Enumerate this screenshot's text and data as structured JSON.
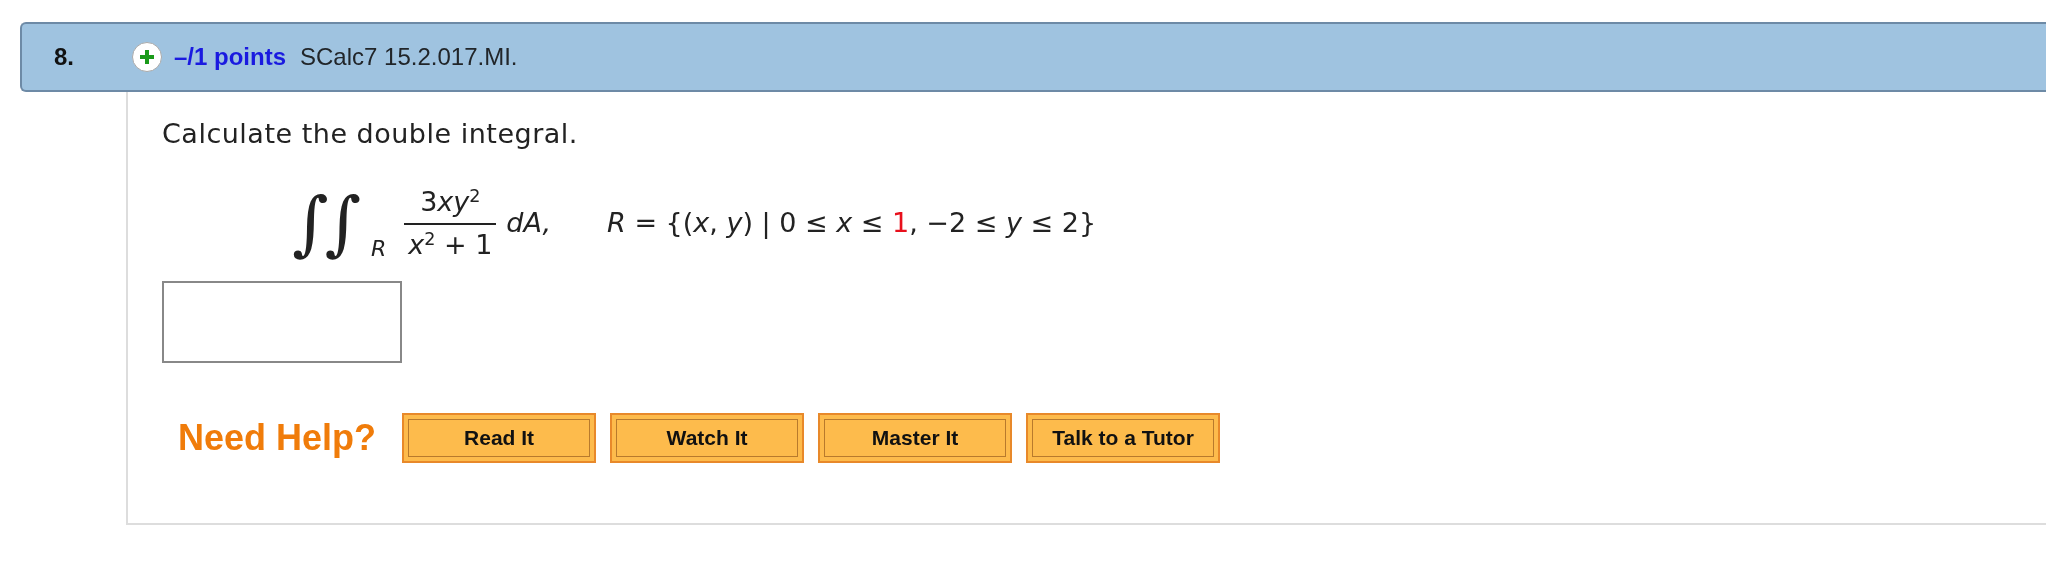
{
  "question": {
    "number": "8.",
    "expanded": false,
    "points": "–/1 points",
    "problem_id": "SCalc7 15.2.017.MI."
  },
  "prompt": "Calculate the double integral.",
  "formula": {
    "integral": "∫∫",
    "domain": "R",
    "numerator": [
      {
        "text": "3",
        "kind": "plain"
      },
      {
        "text": "xy",
        "kind": "italic"
      },
      {
        "text": "2",
        "kind": "sup"
      }
    ],
    "denominator": [
      {
        "text": "x",
        "kind": "italic"
      },
      {
        "text": "2",
        "kind": "sup"
      },
      {
        "text": " + 1",
        "kind": "plain"
      }
    ],
    "differential": "dA,",
    "region": [
      {
        "text": "*R* = {(*x*, *y*) | 0 ≤ *x* ≤ ",
        "randomized": false
      },
      {
        "text": "1",
        "randomized": true
      },
      {
        "text": ", −2 ≤ *y* ≤ 2}",
        "randomized": false
      }
    ]
  },
  "help": {
    "label": "Need Help?",
    "buttons": [
      "Read It",
      "Watch It",
      "Master It",
      "Talk to a Tutor"
    ]
  }
}
